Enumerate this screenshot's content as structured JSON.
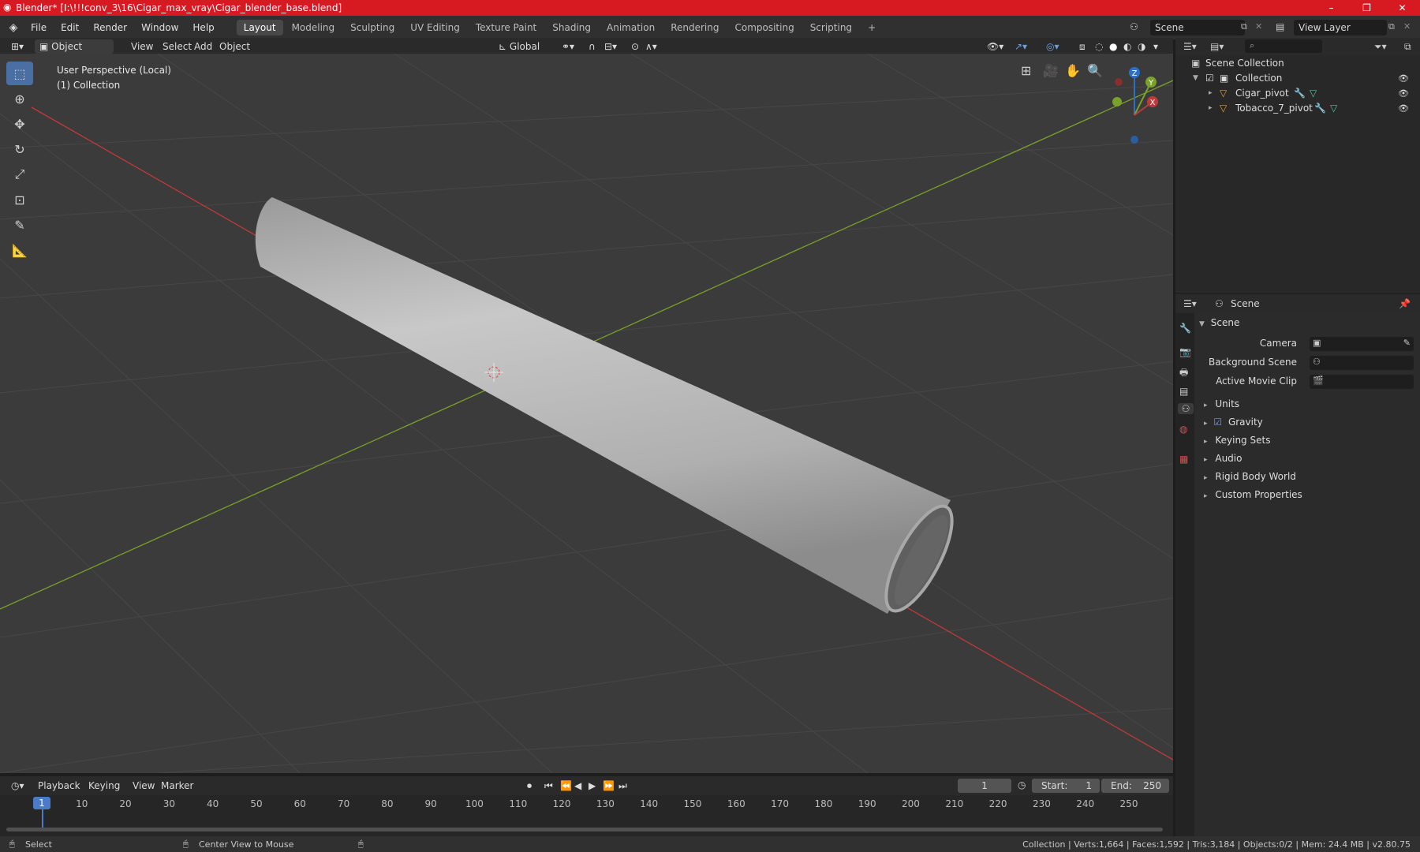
{
  "window": {
    "title": "Blender* [I:\\!!!conv_3\\16\\Cigar_max_vray\\Cigar_blender_base.blend]",
    "minimize": "–",
    "maximize": "❐",
    "close": "✕"
  },
  "menu": {
    "items": [
      "File",
      "Edit",
      "Render",
      "Window",
      "Help"
    ],
    "workspaces": [
      "Layout",
      "Modeling",
      "Sculpting",
      "UV Editing",
      "Texture Paint",
      "Shading",
      "Animation",
      "Rendering",
      "Compositing",
      "Scripting"
    ],
    "active_workspace": "Layout",
    "add_tab": "+",
    "scene_value": "Scene",
    "view_layer_value": "View Layer"
  },
  "viewport_header": {
    "mode": "Object Mode",
    "menus": [
      "View",
      "Select",
      "Add",
      "Object"
    ],
    "orientation": "Global"
  },
  "viewport": {
    "perspective_label": "User Perspective (Local)",
    "collection_label": "(1) Collection",
    "gizmo": {
      "z": "Z",
      "y": "Y",
      "x": "X"
    },
    "colors": {
      "background": "#3b3b3b",
      "x_axis": "#c0393b",
      "y_axis": "#7aa12a",
      "object": "#b4b4b4",
      "tool_active": "#4a6fa5"
    }
  },
  "toolbar": {
    "tools": [
      "select-box-icon",
      "cursor-icon",
      "move-icon",
      "rotate-icon",
      "scale-icon",
      "transform-icon",
      "annotate-icon",
      "measure-icon"
    ]
  },
  "outliner": {
    "search_placeholder": "",
    "root": "Scene Collection",
    "collection": "Collection",
    "objects": [
      "Cigar_pivot",
      "Tobacco_7_pivot"
    ]
  },
  "properties": {
    "header_title": "Scene",
    "section_title": "Scene",
    "fields": [
      {
        "label": "Camera"
      },
      {
        "label": "Background Scene"
      },
      {
        "label": "Active Movie Clip"
      }
    ],
    "subsections": [
      "Units",
      "Gravity",
      "Keying Sets",
      "Audio",
      "Rigid Body World",
      "Custom Properties"
    ],
    "gravity_checked": true
  },
  "timeline": {
    "menus": [
      "Playback",
      "Keying",
      "View",
      "Marker"
    ],
    "current_frame": "1",
    "start_label": "Start:",
    "start_value": "1",
    "end_label": "End:",
    "end_value": "250",
    "ticks": [
      "1",
      "10",
      "20",
      "30",
      "40",
      "50",
      "60",
      "70",
      "80",
      "90",
      "100",
      "110",
      "120",
      "130",
      "140",
      "150",
      "160",
      "170",
      "180",
      "190",
      "200",
      "210",
      "220",
      "230",
      "240",
      "250"
    ]
  },
  "statusbar": {
    "left_action": "Select",
    "middle_action": "Center View to Mouse",
    "stats": "Collection | Verts:1,664 | Faces:1,592 | Tris:3,184 | Objects:0/2 | Mem: 24.4 MB | v2.80.75"
  }
}
